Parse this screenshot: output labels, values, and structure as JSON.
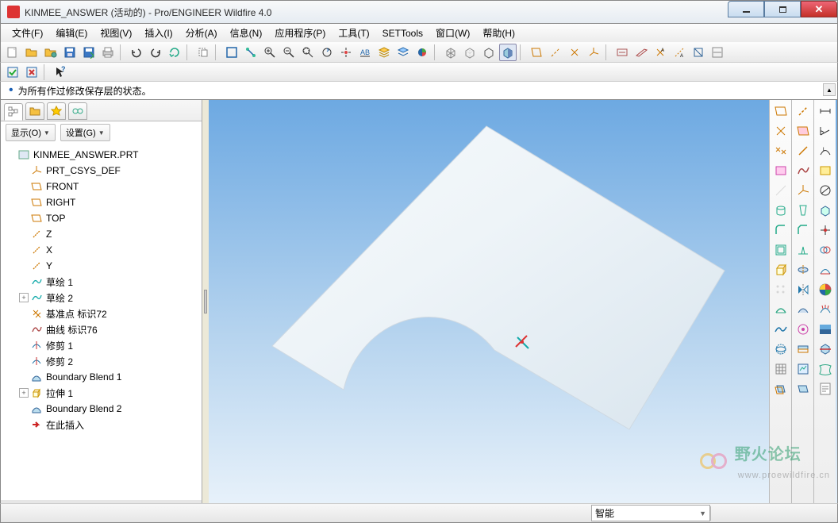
{
  "window": {
    "title": "KINMEE_ANSWER (活动的) - Pro/ENGINEER Wildfire 4.0"
  },
  "menu": {
    "file": "文件(F)",
    "edit": "编辑(E)",
    "view": "视图(V)",
    "insert": "插入(I)",
    "analysis": "分析(A)",
    "info": "信息(N)",
    "apps": "应用程序(P)",
    "tools": "工具(T)",
    "settools": "SETTools",
    "window": "窗口(W)",
    "help": "帮助(H)"
  },
  "message": "为所有作过修改保存层的状态。",
  "sidebar": {
    "show_label": "显示(O)",
    "settings_label": "设置(G)"
  },
  "tree": [
    {
      "label": "KINMEE_ANSWER.PRT",
      "indent": 0,
      "icon": "part",
      "exp": "none"
    },
    {
      "label": "PRT_CSYS_DEF",
      "indent": 1,
      "icon": "csys",
      "exp": "blank"
    },
    {
      "label": "FRONT",
      "indent": 1,
      "icon": "plane",
      "exp": "blank"
    },
    {
      "label": "RIGHT",
      "indent": 1,
      "icon": "plane",
      "exp": "blank"
    },
    {
      "label": "TOP",
      "indent": 1,
      "icon": "plane",
      "exp": "blank"
    },
    {
      "label": "Z",
      "indent": 1,
      "icon": "axis",
      "exp": "blank"
    },
    {
      "label": "X",
      "indent": 1,
      "icon": "axis",
      "exp": "blank"
    },
    {
      "label": "Y",
      "indent": 1,
      "icon": "axis",
      "exp": "blank"
    },
    {
      "label": "草绘 1",
      "indent": 1,
      "icon": "sketch",
      "exp": "blank"
    },
    {
      "label": "草绘 2",
      "indent": 1,
      "icon": "sketch",
      "exp": "plus"
    },
    {
      "label": "基准点 标识72",
      "indent": 1,
      "icon": "point",
      "exp": "blank"
    },
    {
      "label": "曲线 标识76",
      "indent": 1,
      "icon": "curve",
      "exp": "blank"
    },
    {
      "label": "修剪 1",
      "indent": 1,
      "icon": "trim",
      "exp": "blank"
    },
    {
      "label": "修剪 2",
      "indent": 1,
      "icon": "trim",
      "exp": "blank"
    },
    {
      "label": "Boundary Blend 1",
      "indent": 1,
      "icon": "blend",
      "exp": "blank"
    },
    {
      "label": "拉伸 1",
      "indent": 1,
      "icon": "extrude",
      "exp": "plus"
    },
    {
      "label": "Boundary Blend 2",
      "indent": 1,
      "icon": "blend",
      "exp": "blank"
    },
    {
      "label": "在此插入",
      "indent": 1,
      "icon": "insert",
      "exp": "blank"
    }
  ],
  "status": {
    "smart": "智能"
  },
  "watermark": {
    "text": "野火论坛",
    "sub": "www.proewildfire.cn"
  }
}
